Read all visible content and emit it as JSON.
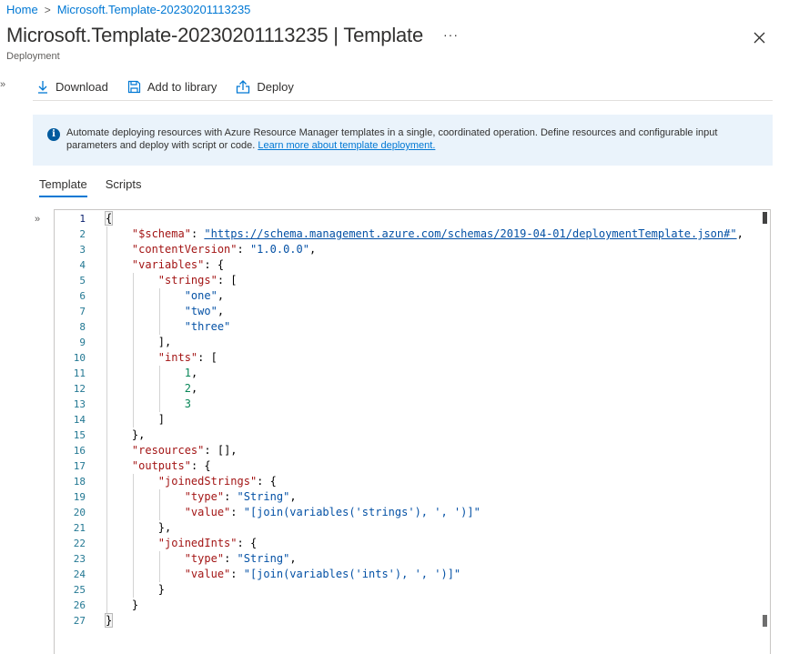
{
  "breadcrumb": {
    "home": "Home",
    "separator": ">",
    "current": "Microsoft.Template-20230201113235"
  },
  "header": {
    "title": "Microsoft.Template-20230201113235",
    "title_suffix": " | Template",
    "more": "···",
    "subtitle": "Deployment"
  },
  "toolbar": {
    "download_label": "Download",
    "add_library_label": "Add to library",
    "deploy_label": "Deploy"
  },
  "info": {
    "text": "Automate deploying resources with Azure Resource Manager templates in a single, coordinated operation. Define resources and configurable input parameters and deploy with script or code. ",
    "link": "Learn more about template deployment."
  },
  "tabs": [
    {
      "label": "Template",
      "active": true
    },
    {
      "label": "Scripts",
      "active": false
    }
  ],
  "collapse": "»",
  "editor": {
    "lines": [
      {
        "n": "1",
        "indent": 0,
        "tokens": [
          [
            "brace",
            "{"
          ]
        ]
      },
      {
        "n": "2",
        "indent": 1,
        "tokens": [
          [
            "key",
            "\"$schema\""
          ],
          [
            "punct",
            ": "
          ],
          [
            "url",
            "\"https://schema.management.azure.com/schemas/2019-04-01/deploymentTemplate.json#\""
          ],
          [
            "punct",
            ","
          ]
        ]
      },
      {
        "n": "3",
        "indent": 1,
        "tokens": [
          [
            "key",
            "\"contentVersion\""
          ],
          [
            "punct",
            ": "
          ],
          [
            "str",
            "\"1.0.0.0\""
          ],
          [
            "punct",
            ","
          ]
        ]
      },
      {
        "n": "4",
        "indent": 1,
        "tokens": [
          [
            "key",
            "\"variables\""
          ],
          [
            "punct",
            ": {"
          ]
        ]
      },
      {
        "n": "5",
        "indent": 2,
        "tokens": [
          [
            "key",
            "\"strings\""
          ],
          [
            "punct",
            ": ["
          ]
        ]
      },
      {
        "n": "6",
        "indent": 3,
        "tokens": [
          [
            "str",
            "\"one\""
          ],
          [
            "punct",
            ","
          ]
        ]
      },
      {
        "n": "7",
        "indent": 3,
        "tokens": [
          [
            "str",
            "\"two\""
          ],
          [
            "punct",
            ","
          ]
        ]
      },
      {
        "n": "8",
        "indent": 3,
        "tokens": [
          [
            "str",
            "\"three\""
          ]
        ]
      },
      {
        "n": "9",
        "indent": 2,
        "tokens": [
          [
            "punct",
            "],"
          ]
        ]
      },
      {
        "n": "10",
        "indent": 2,
        "tokens": [
          [
            "key",
            "\"ints\""
          ],
          [
            "punct",
            ": ["
          ]
        ]
      },
      {
        "n": "11",
        "indent": 3,
        "tokens": [
          [
            "num",
            "1"
          ],
          [
            "punct",
            ","
          ]
        ]
      },
      {
        "n": "12",
        "indent": 3,
        "tokens": [
          [
            "num",
            "2"
          ],
          [
            "punct",
            ","
          ]
        ]
      },
      {
        "n": "13",
        "indent": 3,
        "tokens": [
          [
            "num",
            "3"
          ]
        ]
      },
      {
        "n": "14",
        "indent": 2,
        "tokens": [
          [
            "punct",
            "]"
          ]
        ]
      },
      {
        "n": "15",
        "indent": 1,
        "tokens": [
          [
            "punct",
            "},"
          ]
        ]
      },
      {
        "n": "16",
        "indent": 1,
        "tokens": [
          [
            "key",
            "\"resources\""
          ],
          [
            "punct",
            ": [],"
          ]
        ]
      },
      {
        "n": "17",
        "indent": 1,
        "tokens": [
          [
            "key",
            "\"outputs\""
          ],
          [
            "punct",
            ": {"
          ]
        ]
      },
      {
        "n": "18",
        "indent": 2,
        "tokens": [
          [
            "key",
            "\"joinedStrings\""
          ],
          [
            "punct",
            ": {"
          ]
        ]
      },
      {
        "n": "19",
        "indent": 3,
        "tokens": [
          [
            "key",
            "\"type\""
          ],
          [
            "punct",
            ": "
          ],
          [
            "str",
            "\"String\""
          ],
          [
            "punct",
            ","
          ]
        ]
      },
      {
        "n": "20",
        "indent": 3,
        "tokens": [
          [
            "key",
            "\"value\""
          ],
          [
            "punct",
            ": "
          ],
          [
            "str",
            "\"[join(variables('strings'), ', ')]\""
          ]
        ]
      },
      {
        "n": "21",
        "indent": 2,
        "tokens": [
          [
            "punct",
            "},"
          ]
        ]
      },
      {
        "n": "22",
        "indent": 2,
        "tokens": [
          [
            "key",
            "\"joinedInts\""
          ],
          [
            "punct",
            ": {"
          ]
        ]
      },
      {
        "n": "23",
        "indent": 3,
        "tokens": [
          [
            "key",
            "\"type\""
          ],
          [
            "punct",
            ": "
          ],
          [
            "str",
            "\"String\""
          ],
          [
            "punct",
            ","
          ]
        ]
      },
      {
        "n": "24",
        "indent": 3,
        "tokens": [
          [
            "key",
            "\"value\""
          ],
          [
            "punct",
            ": "
          ],
          [
            "str",
            "\"[join(variables('ints'), ', ')]\""
          ]
        ]
      },
      {
        "n": "25",
        "indent": 2,
        "tokens": [
          [
            "punct",
            "}"
          ]
        ]
      },
      {
        "n": "26",
        "indent": 1,
        "tokens": [
          [
            "punct",
            "}"
          ]
        ]
      },
      {
        "n": "27",
        "indent": 0,
        "tokens": [
          [
            "brace",
            "}"
          ]
        ]
      }
    ]
  },
  "colors": {
    "accent": "#0078d4",
    "key": "#a31515",
    "string": "#0451a5",
    "number": "#098658",
    "line_number": "#237893",
    "info_background": "#eaf3fb"
  }
}
